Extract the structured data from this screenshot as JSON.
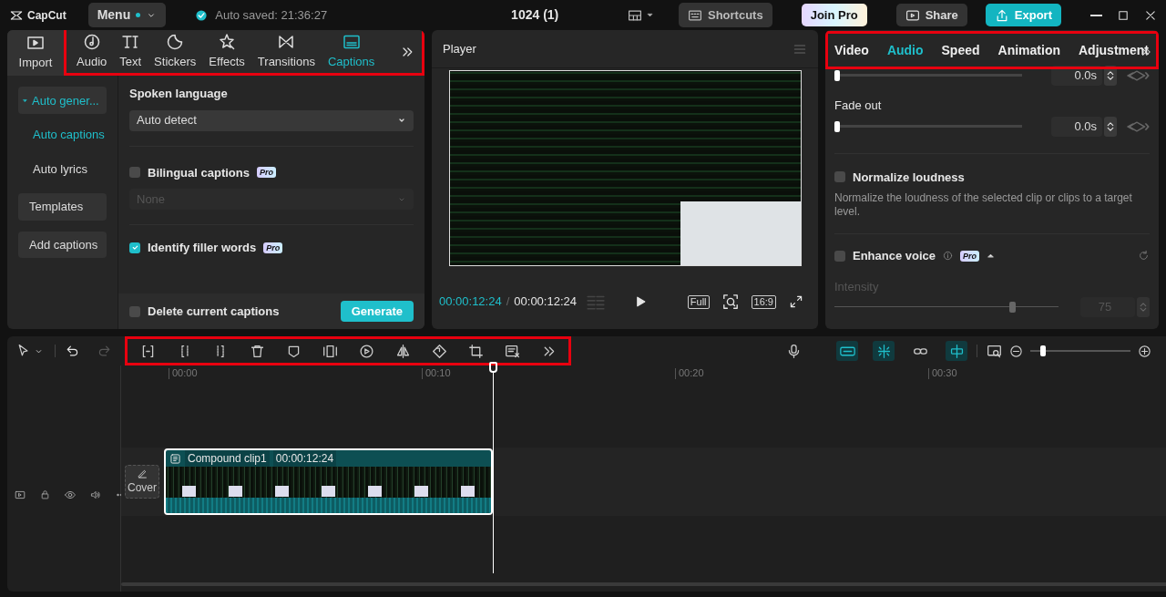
{
  "app": {
    "logo": "CapCut",
    "menu": "Menu",
    "autosave": "Auto saved: 21:36:27",
    "project_title": "1024 (1)"
  },
  "top_buttons": [
    {
      "kind": "shortcuts",
      "label": "Shortcuts"
    },
    {
      "kind": "pro",
      "label": "Join Pro"
    },
    {
      "kind": "share",
      "label": "Share"
    },
    {
      "kind": "export",
      "label": "Export"
    }
  ],
  "media_tabs": [
    {
      "kind": "import",
      "label": "Import",
      "selected": false
    },
    {
      "kind": "audio",
      "label": "Audio",
      "selected": false
    },
    {
      "kind": "text",
      "label": "Text",
      "selected": false
    },
    {
      "kind": "stickers",
      "label": "Stickers",
      "selected": false
    },
    {
      "kind": "effects",
      "label": "Effects",
      "selected": false
    },
    {
      "kind": "transitions",
      "label": "Transitions",
      "selected": false
    },
    {
      "kind": "captions",
      "label": "Captions",
      "selected": true
    }
  ],
  "caption_nav": [
    {
      "kind": "group",
      "label": "Auto gener...",
      "selected": true,
      "expanded": true
    },
    {
      "kind": "sub",
      "label": "Auto captions",
      "selected": true
    },
    {
      "kind": "sub",
      "label": "Auto lyrics",
      "selected": false
    },
    {
      "kind": "item",
      "label": "Templates",
      "selected": false
    },
    {
      "kind": "item",
      "label": "Add captions",
      "selected": false
    }
  ],
  "captions_panel": {
    "language_label": "Spoken language",
    "language": "Auto detect",
    "options": [
      {
        "label": "Bilingual captions",
        "checked": false,
        "badge": "Pro",
        "dropdown": {
          "value": "None",
          "disabled": true
        }
      },
      {
        "label": "Identify filler words",
        "checked": true,
        "badge": "Pro"
      }
    ],
    "footer": {
      "label": "Delete current captions",
      "checked": false,
      "button": "Generate"
    }
  },
  "player": {
    "title": "Player",
    "current_time": "00:00:12:24",
    "separator": "/",
    "total_time": "00:00:12:24",
    "full": "Full",
    "ratio": "16:9"
  },
  "inspector": {
    "tabs": [
      {
        "label": "Video",
        "selected": false
      },
      {
        "label": "Audio",
        "selected": true
      },
      {
        "label": "Speed",
        "selected": false
      },
      {
        "label": "Animation",
        "selected": false
      },
      {
        "label": "Adjustment",
        "selected": false
      }
    ],
    "fades": [
      {
        "value": "0.0s",
        "level": 0
      },
      {
        "label": "Fade out",
        "value": "0.0s",
        "level": 0
      }
    ],
    "normalize": {
      "label": "Normalize loudness",
      "checked": false,
      "description": "Normalize the loudness of the selected clip or clips to a target level."
    },
    "enhance": {
      "label": "Enhance voice",
      "checked": false,
      "badge": "Pro",
      "expanded": true,
      "intensity_label": "Intensity",
      "level": 0.78,
      "value": "75",
      "disabled": true
    }
  },
  "timeline": {
    "toggles": [
      {
        "kind": "magnet",
        "on": true
      },
      {
        "kind": "snap",
        "on": true
      },
      {
        "kind": "link",
        "on": false
      },
      {
        "kind": "split",
        "on": true
      }
    ],
    "zoom": {
      "level": 0.1
    },
    "ruler": [
      "00:00",
      "00:10",
      "00:20",
      "00:30"
    ],
    "cover": "Cover",
    "clip": {
      "name": "Compound clip1",
      "duration": "00:00:12:24"
    }
  }
}
